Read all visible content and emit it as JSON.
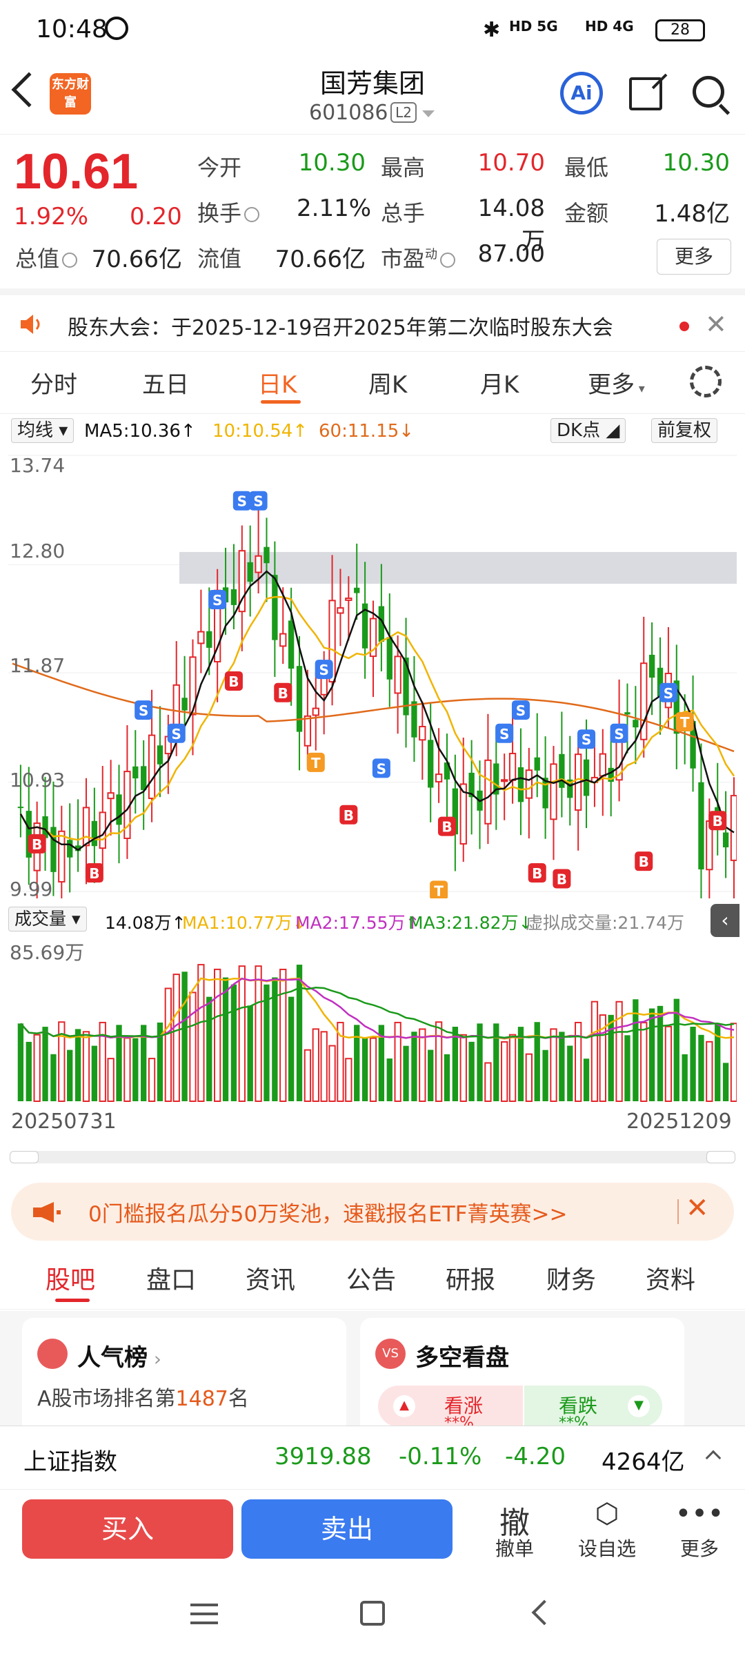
{
  "status": {
    "time": "10:48",
    "net1": "HD 5G",
    "net2": "HD 4G",
    "battery": "28"
  },
  "header": {
    "name": "国芳集团",
    "code": "601086",
    "level": "L2",
    "logo_text": "东方财富",
    "ai": "Ai"
  },
  "quote": {
    "price": "10.61",
    "change_pct": "1.92%",
    "change": "0.20",
    "open_label": "今开",
    "open": "10.30",
    "high_label": "最高",
    "high": "10.70",
    "low_label": "最低",
    "low": "10.30",
    "turnover_label": "换手",
    "turnover": "2.11%",
    "vol_label": "总手",
    "vol": "14.08万",
    "amount_label": "金额",
    "amount": "1.48亿",
    "mcap_label": "总值",
    "mcap": "70.66亿",
    "float_label": "流值",
    "float": "70.66亿",
    "pe_label": "市盈",
    "pe_sup": "动",
    "pe": "87.00",
    "more": "更多"
  },
  "notice": {
    "text": "股东大会：于2025-12-19召开2025年第二次临时股东大会"
  },
  "ktabs": [
    "分时",
    "五日",
    "日K",
    "周K",
    "月K",
    "更多"
  ],
  "ma": {
    "selector": "均线",
    "ma5": "MA5:10.36↑",
    "ma10": "10:10.54↑",
    "ma60": "60:11.15↓",
    "dk": "DK点",
    "adjust": "前复权"
  },
  "kchart": {
    "y_labels": [
      "13.74",
      "12.80",
      "11.87",
      "10.93",
      "9.99"
    ]
  },
  "vol": {
    "selector": "成交量",
    "vol": "14.08万↑",
    "ma1": "MA1:10.77万↓",
    "ma2": "MA2:17.55万↑",
    "ma3": "MA3:21.82万↓",
    "virtual": "虚拟成交量:21.74万",
    "max": "85.69万",
    "date_start": "20250731",
    "date_end": "20251209"
  },
  "colors": {
    "up": "#e3262b",
    "down": "#1a9a1a",
    "ma5": "#111111",
    "ma10": "#f0b400",
    "ma60": "#e06a1a"
  },
  "promo": {
    "text": "0门槛报名瓜分50万奖池，速戳报名ETF菁英赛>>"
  },
  "btabs": [
    "股吧",
    "盘口",
    "资讯",
    "公告",
    "研报",
    "财务",
    "资料"
  ],
  "cards": {
    "popular_title": "人气榜",
    "rank_prefix": "A股市场排名第",
    "rank": "1487",
    "rank_suffix": "名",
    "vs_title": "多空看盘",
    "bull": "看涨",
    "bear": "看跌",
    "bull_val": "**%",
    "bear_val": "**%"
  },
  "index": {
    "name": "上证指数",
    "value": "3919.88",
    "pct": "-0.11%",
    "chg": "-4.20",
    "turnover": "4264亿"
  },
  "trade": {
    "buy": "买入",
    "sell": "卖出",
    "cancel_icon": "撤",
    "cancel": "撤单",
    "watch": "设自选",
    "more": "更多"
  }
}
